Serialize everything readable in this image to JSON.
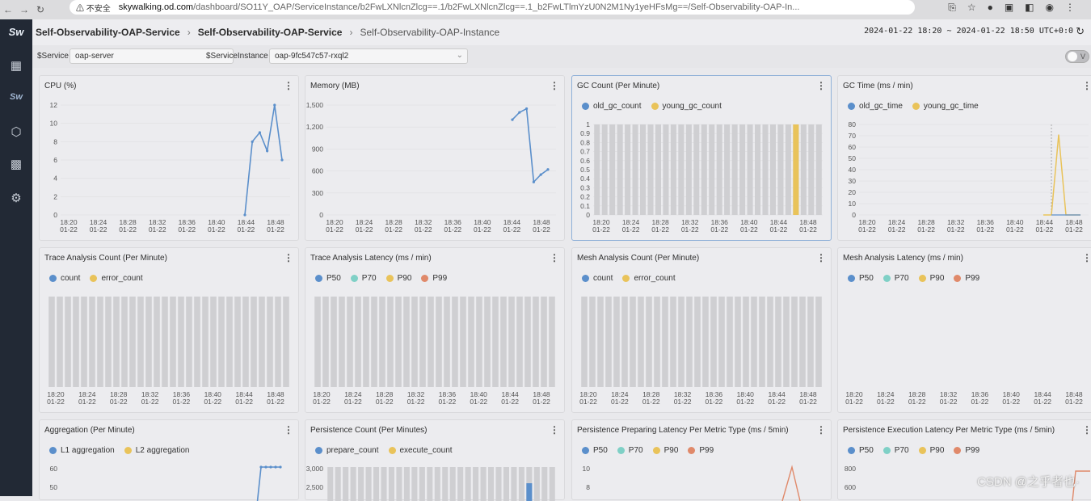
{
  "browser": {
    "security": "⚠ 不安全",
    "host": "skywalking.od.com",
    "path": "/dashboard/SO11Y_OAP/ServiceInstance/b2FwLXNlcnZlcg==.1/b2FwLXNlcnZlcg==.1_b2FwLTlmYzU0N2M1Ny1yeHFsMg==/Self-Observability-OAP-In..."
  },
  "breadcrumb": {
    "item1": "Self-Observability-OAP-Service",
    "item2": "Self-Observability-OAP-Service",
    "item3": "Self-Observability-OAP-Instance"
  },
  "time_range": "2024-01-22 18:20 ~ 2024-01-22 18:50",
  "timezone": "UTC+0:0",
  "filters": {
    "service_label": "$Service",
    "service_value": "oap-server",
    "instance_label": "$ServiceInstance",
    "instance_value": "oap-9fc547c57-rxql2",
    "toggle_label": "V"
  },
  "colors": {
    "blue": "#5b8fcb",
    "yellow": "#e9c35a",
    "teal": "#7fd0c6",
    "orange": "#e0896a",
    "bar": "#cfcfd2"
  },
  "x_ticks": [
    "18:20",
    "18:24",
    "18:28",
    "18:32",
    "18:36",
    "18:40",
    "18:44",
    "18:48"
  ],
  "x_date": "01-22",
  "panels": [
    {
      "title": "CPU (%)",
      "legend": [],
      "y_ticks": [
        "12",
        "10",
        "8",
        "6",
        "4",
        "2",
        "0"
      ]
    },
    {
      "title": "Memory (MB)",
      "legend": [],
      "y_ticks": [
        "1,500",
        "1,200",
        "900",
        "600",
        "300",
        "0"
      ]
    },
    {
      "title": "GC Count (Per Minute)",
      "legend": [
        {
          "name": "old_gc_count",
          "color": "#5b8fcb"
        },
        {
          "name": "young_gc_count",
          "color": "#e9c35a"
        }
      ],
      "y_ticks": [
        "1",
        "0.9",
        "0.8",
        "0.7",
        "0.6",
        "0.5",
        "0.4",
        "0.3",
        "0.2",
        "0.1",
        "0"
      ]
    },
    {
      "title": "GC Time (ms / min)",
      "legend": [
        {
          "name": "old_gc_time",
          "color": "#5b8fcb"
        },
        {
          "name": "young_gc_time",
          "color": "#e9c35a"
        }
      ],
      "y_ticks": [
        "80",
        "70",
        "60",
        "50",
        "40",
        "30",
        "20",
        "10",
        "0"
      ]
    },
    {
      "title": "Trace Analysis Count (Per Minute)",
      "legend": [
        {
          "name": "count",
          "color": "#5b8fcb"
        },
        {
          "name": "error_count",
          "color": "#e9c35a"
        }
      ],
      "y_ticks": []
    },
    {
      "title": "Trace Analysis Latency (ms / min)",
      "legend": [
        {
          "name": "P50",
          "color": "#5b8fcb"
        },
        {
          "name": "P70",
          "color": "#7fd0c6"
        },
        {
          "name": "P90",
          "color": "#e9c35a"
        },
        {
          "name": "P99",
          "color": "#e0896a"
        }
      ],
      "y_ticks": []
    },
    {
      "title": "Mesh Analysis Count (Per Minute)",
      "legend": [
        {
          "name": "count",
          "color": "#5b8fcb"
        },
        {
          "name": "error_count",
          "color": "#e9c35a"
        }
      ],
      "y_ticks": []
    },
    {
      "title": "Mesh Analysis Latency (ms / min)",
      "legend": [
        {
          "name": "P50",
          "color": "#5b8fcb"
        },
        {
          "name": "P70",
          "color": "#7fd0c6"
        },
        {
          "name": "P90",
          "color": "#e9c35a"
        },
        {
          "name": "P99",
          "color": "#e0896a"
        }
      ],
      "y_ticks": []
    },
    {
      "title": "Aggregation (Per Minute)",
      "legend": [
        {
          "name": "L1 aggregation",
          "color": "#5b8fcb"
        },
        {
          "name": "L2 aggregation",
          "color": "#e9c35a"
        }
      ],
      "y_ticks": [
        "60",
        "50",
        "40"
      ]
    },
    {
      "title": "Persistence Count (Per Minutes)",
      "legend": [
        {
          "name": "prepare_count",
          "color": "#5b8fcb"
        },
        {
          "name": "execute_count",
          "color": "#e9c35a"
        }
      ],
      "y_ticks": [
        "3,000",
        "2,500",
        "2,000"
      ]
    },
    {
      "title": "Persistence Preparing Latency Per Metric Type (ms / 5min)",
      "legend": [
        {
          "name": "P50",
          "color": "#5b8fcb"
        },
        {
          "name": "P70",
          "color": "#7fd0c6"
        },
        {
          "name": "P90",
          "color": "#e9c35a"
        },
        {
          "name": "P99",
          "color": "#e0896a"
        }
      ],
      "y_ticks": [
        "10",
        "8"
      ]
    },
    {
      "title": "Persistence Execution Latency Per Metric Type (ms / 5min)",
      "legend": [
        {
          "name": "P50",
          "color": "#5b8fcb"
        },
        {
          "name": "P70",
          "color": "#7fd0c6"
        },
        {
          "name": "P90",
          "color": "#e9c35a"
        },
        {
          "name": "P99",
          "color": "#e0896a"
        }
      ],
      "y_ticks": [
        "800",
        "600"
      ]
    }
  ],
  "series": {
    "cpu": [
      0,
      8,
      9,
      7,
      12,
      6
    ],
    "memory": [
      1300,
      1400,
      1450,
      450,
      550,
      620
    ],
    "gc_count_young": 1,
    "gc_time_young_peak": 71,
    "aggregation_l1": [
      5,
      60,
      60,
      60,
      60,
      60
    ],
    "persistence_execute": 2550,
    "prep_p99_peak": 10,
    "exec_p99": 750
  },
  "watermark": "CSDN @之乎者也·"
}
